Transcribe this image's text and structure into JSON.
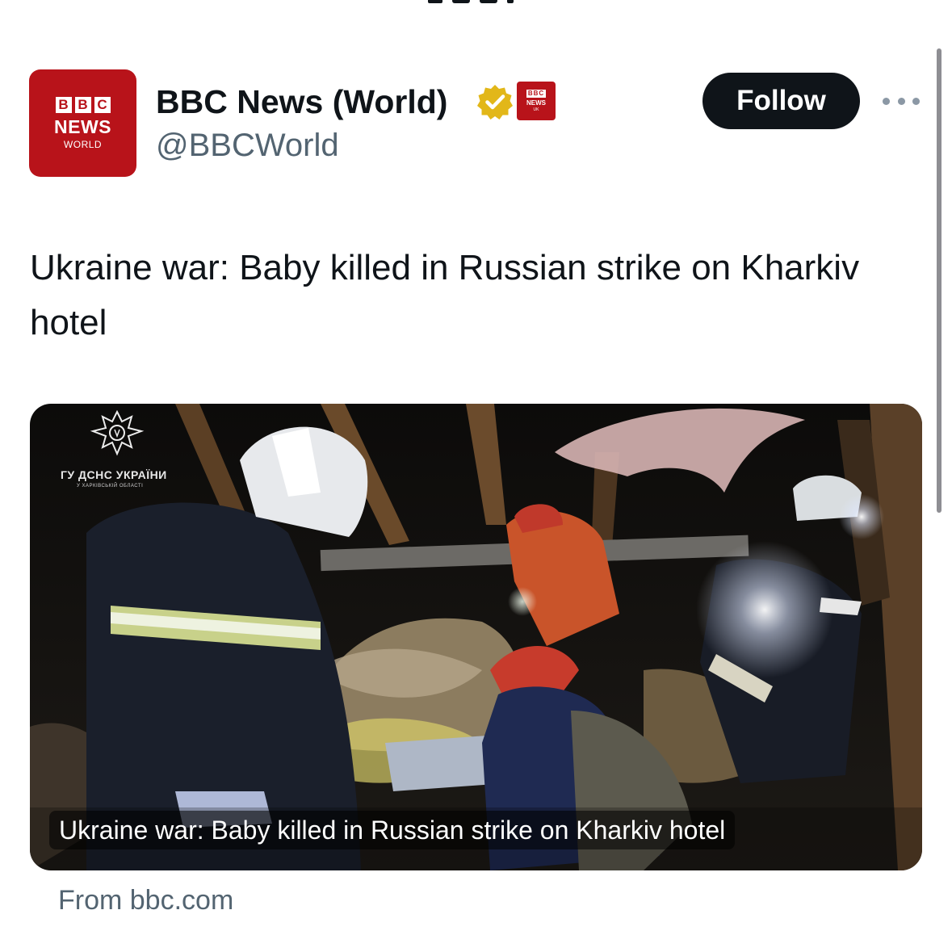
{
  "author": {
    "avatar": {
      "bbc_letters": [
        "B",
        "B",
        "C"
      ],
      "news": "NEWS",
      "world": "WORLD"
    },
    "display_name": "BBC News (World)",
    "handle": "@BBCWorld",
    "verified_icon": "verified-badge-icon",
    "affiliate_badge": {
      "top": "BBC",
      "mid": "NEWS",
      "bottom": "UK"
    },
    "follow_label": "Follow",
    "more_icon": "more-options-icon"
  },
  "tweet": {
    "text": "Ukraine war: Baby killed in Russian strike on Kharkiv hotel"
  },
  "link_card": {
    "image_overlay": {
      "org_name": "ГУ ДСНС УКРАЇНИ",
      "org_region": "У ХАРКІВСЬКІЙ ОБЛАСТІ"
    },
    "caption": "Ukraine war: Baby killed in Russian strike on Kharkiv hotel",
    "source": "From bbc.com"
  },
  "colors": {
    "bbc_red": "#b8131a",
    "text_primary": "#0f1419",
    "text_secondary": "#536471",
    "verified_gold": "#e2b719",
    "button_dark": "#0f1419"
  }
}
